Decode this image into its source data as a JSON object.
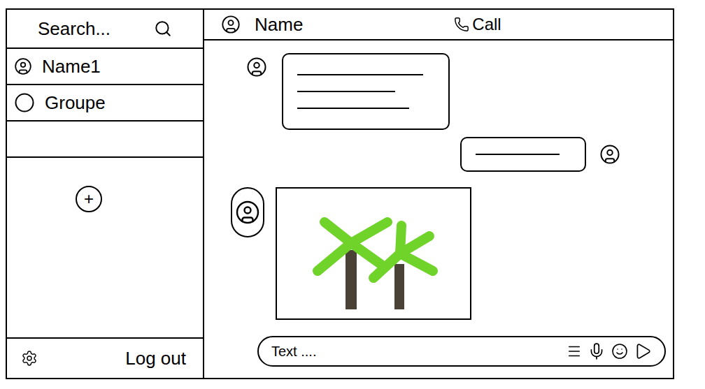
{
  "sidebar": {
    "search": {
      "placeholder": "Search..."
    },
    "items": [
      {
        "name": "Name1",
        "kind": "contact",
        "selected": false
      },
      {
        "name": "Groupe",
        "kind": "group",
        "selected": false
      }
    ],
    "add_button": "+",
    "logout": "Log out"
  },
  "chat": {
    "header": {
      "name": "Name",
      "call": "Call"
    },
    "messages": [
      {
        "kind": "text",
        "outgoing": false,
        "line_count": 3
      },
      {
        "kind": "text",
        "outgoing": true,
        "line_count": 1
      },
      {
        "kind": "image",
        "outgoing": false
      }
    ]
  },
  "composer": {
    "placeholder": "Text ...."
  }
}
